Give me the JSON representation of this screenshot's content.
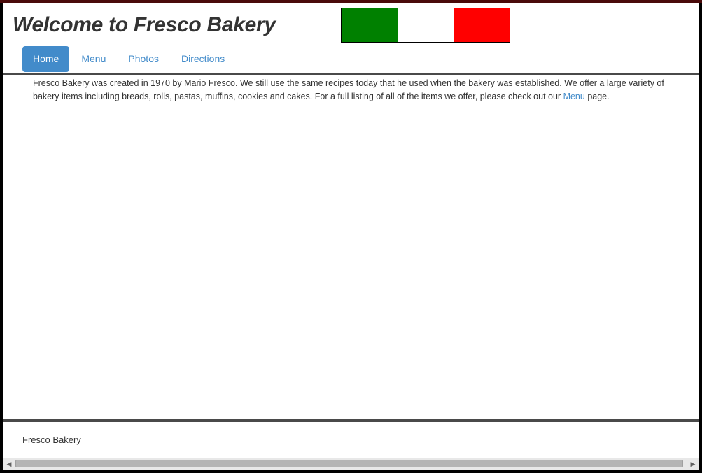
{
  "header": {
    "title": "Welcome to Fresco Bakery",
    "flag_colors": [
      "#008000",
      "#ffffff",
      "#ff0000"
    ]
  },
  "nav": {
    "items": [
      {
        "label": "Home",
        "active": true
      },
      {
        "label": "Menu",
        "active": false
      },
      {
        "label": "Photos",
        "active": false
      },
      {
        "label": "Directions",
        "active": false
      }
    ]
  },
  "main": {
    "intro_before_link": "Fresco Bakery was created in 1970 by Mario Fresco. We still use the same recipes today that he used when the bakery was established. We offer a large variety of bakery items including breads, rolls, pastas, muffins, cookies and cakes. For a full listing of all of the items we offer, please check out our ",
    "intro_link": "Menu",
    "intro_after_link": " page."
  },
  "footer": {
    "text": "Fresco Bakery"
  },
  "colors": {
    "accent": "#428bca",
    "text": "#333333",
    "rule": "#4a4a4a"
  }
}
